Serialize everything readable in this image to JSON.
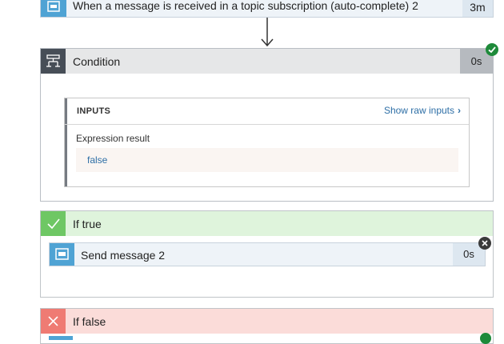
{
  "trigger": {
    "title": "When a message is received in a topic subscription (auto-complete) 2",
    "duration": "3m",
    "icon": "service-bus-icon"
  },
  "condition": {
    "title": "Condition",
    "duration": "0s",
    "icon": "condition-icon",
    "status": "succeeded",
    "inputs": {
      "heading": "INPUTS",
      "raw_link": "Show raw inputs",
      "expression_label": "Expression result",
      "expression_value": "false"
    }
  },
  "if_true": {
    "title": "If true",
    "icon": "checkmark-icon",
    "action": {
      "title": "Send message 2",
      "duration": "0s",
      "icon": "service-bus-icon",
      "status": "skipped"
    }
  },
  "if_false": {
    "title": "If false",
    "icon": "x-icon"
  },
  "colors": {
    "accent_blue": "#4fa3d4",
    "success_green": "#1e8a3a",
    "true_header": "#dff4dc",
    "false_header": "#fbdcd9",
    "condition_dark": "#474e57"
  }
}
